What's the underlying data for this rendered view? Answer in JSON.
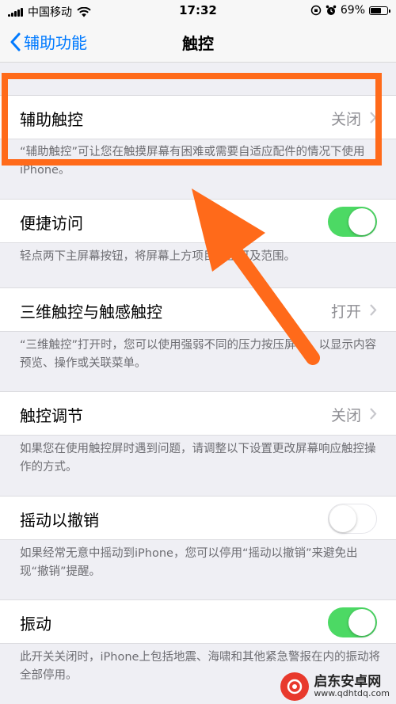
{
  "status_bar": {
    "carrier": "中国移动",
    "time": "17:32",
    "battery": "69%",
    "battery_level": 0.69
  },
  "nav": {
    "back_label": "辅助功能",
    "title": "触控"
  },
  "rows": [
    {
      "label": "辅助触控",
      "value": "关闭",
      "footer": "“辅助触控”可让您在触摸屏幕有困难或需要自适应配件的情况下使用iPhone。"
    },
    {
      "label": "便捷访问",
      "toggle": "on",
      "footer": "轻点两下主屏幕按钮，将屏幕上方项目降至可及范围。"
    },
    {
      "label": "三维触控与触感触控",
      "value": "打开",
      "footer": "“三维触控”打开时，您可以使用强弱不同的压力按压屏幕，以显示内容预览、操作或关联菜单。"
    },
    {
      "label": "触控调节",
      "value": "关闭",
      "footer": "如果您在使用触控屏时遇到问题，请调整以下设置更改屏幕响应触控操作的方式。"
    },
    {
      "label": "摇动以撤销",
      "toggle": "off",
      "footer": "如果经常无意中摇动到iPhone，您可以停用“摇动以撤销”来避免出现“撤销”提醒。"
    },
    {
      "label": "振动",
      "toggle": "on",
      "footer": "此开关关闭时，iPhone上包括地震、海啸和其他紧急警报在内的振动将全部停用。"
    }
  ],
  "watermark": {
    "title": "启东安卓网",
    "url": "www.qdhtdq.com"
  },
  "colors": {
    "accent": "#007aff",
    "toggle_on": "#4cd964",
    "annotation": "#ff6a1a",
    "background": "#efeff4"
  }
}
